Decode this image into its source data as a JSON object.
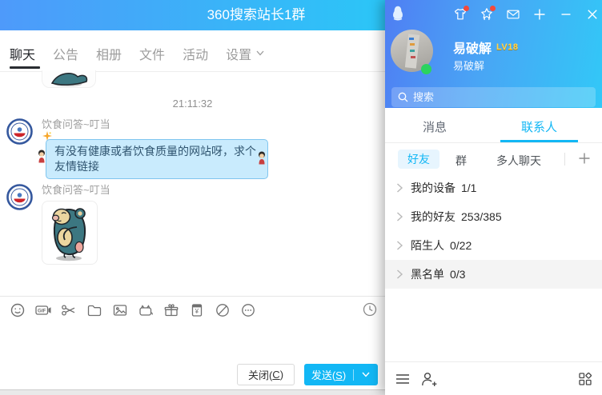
{
  "chat": {
    "title": "360搜索站长1群",
    "tabs": [
      {
        "label": "聊天",
        "active": true
      },
      {
        "label": "公告",
        "active": false
      },
      {
        "label": "相册",
        "active": false
      },
      {
        "label": "文件",
        "active": false
      },
      {
        "label": "活动",
        "active": false
      },
      {
        "label": "设置",
        "active": false,
        "has_dropdown": true
      }
    ],
    "timestamp": "21:11:32",
    "messages": [
      {
        "sender": "饮食问答~叮当",
        "type": "text",
        "text": "有没有健康或者饮食质量的网站呀，求个友情链接"
      },
      {
        "sender": "饮食问答~叮当",
        "type": "sticker",
        "sticker": "teal-monkey-sticker"
      }
    ],
    "toolbar": {
      "icons": [
        "emoji-icon",
        "gif-icon",
        "screenshot-icon",
        "folder-icon",
        "image-icon",
        "sticker-bag-icon",
        "gift-icon",
        "red-packet-icon",
        "prohibit-icon",
        "more-icon",
        "history-clock-icon"
      ],
      "gif_label": "GIF",
      "yuan_symbol": "¥"
    },
    "buttons": {
      "close": {
        "pre": "关闭(",
        "key": "C",
        "post": ")"
      },
      "send": {
        "pre": "发送(",
        "key": "S",
        "post": ")"
      }
    }
  },
  "panel": {
    "window_icons": [
      "dressup-icon",
      "medal-star-icon",
      "mail-icon",
      "plus-icon",
      "minimize-icon",
      "close-icon"
    ],
    "profile": {
      "name": "易破解",
      "level": "LV18",
      "signature": "易破解",
      "status": "online"
    },
    "search": {
      "placeholder": "搜索"
    },
    "tabs": [
      {
        "label": "消息",
        "active": false
      },
      {
        "label": "联系人",
        "active": true
      }
    ],
    "subtabs": [
      {
        "label": "好友",
        "active": true
      },
      {
        "label": "群",
        "active": false
      },
      {
        "label": "多人聊天",
        "active": false
      }
    ],
    "groups": [
      {
        "label": "我的设备",
        "count": "1/1"
      },
      {
        "label": "我的好友",
        "count": "253/385"
      },
      {
        "label": "陌生人",
        "count": "0/22"
      },
      {
        "label": "黑名单",
        "count": "0/3",
        "highlighted": true
      }
    ],
    "colors": {
      "accent": "#12b7f5",
      "online": "#2bd35f",
      "level_badge": "#ffd34d"
    }
  }
}
